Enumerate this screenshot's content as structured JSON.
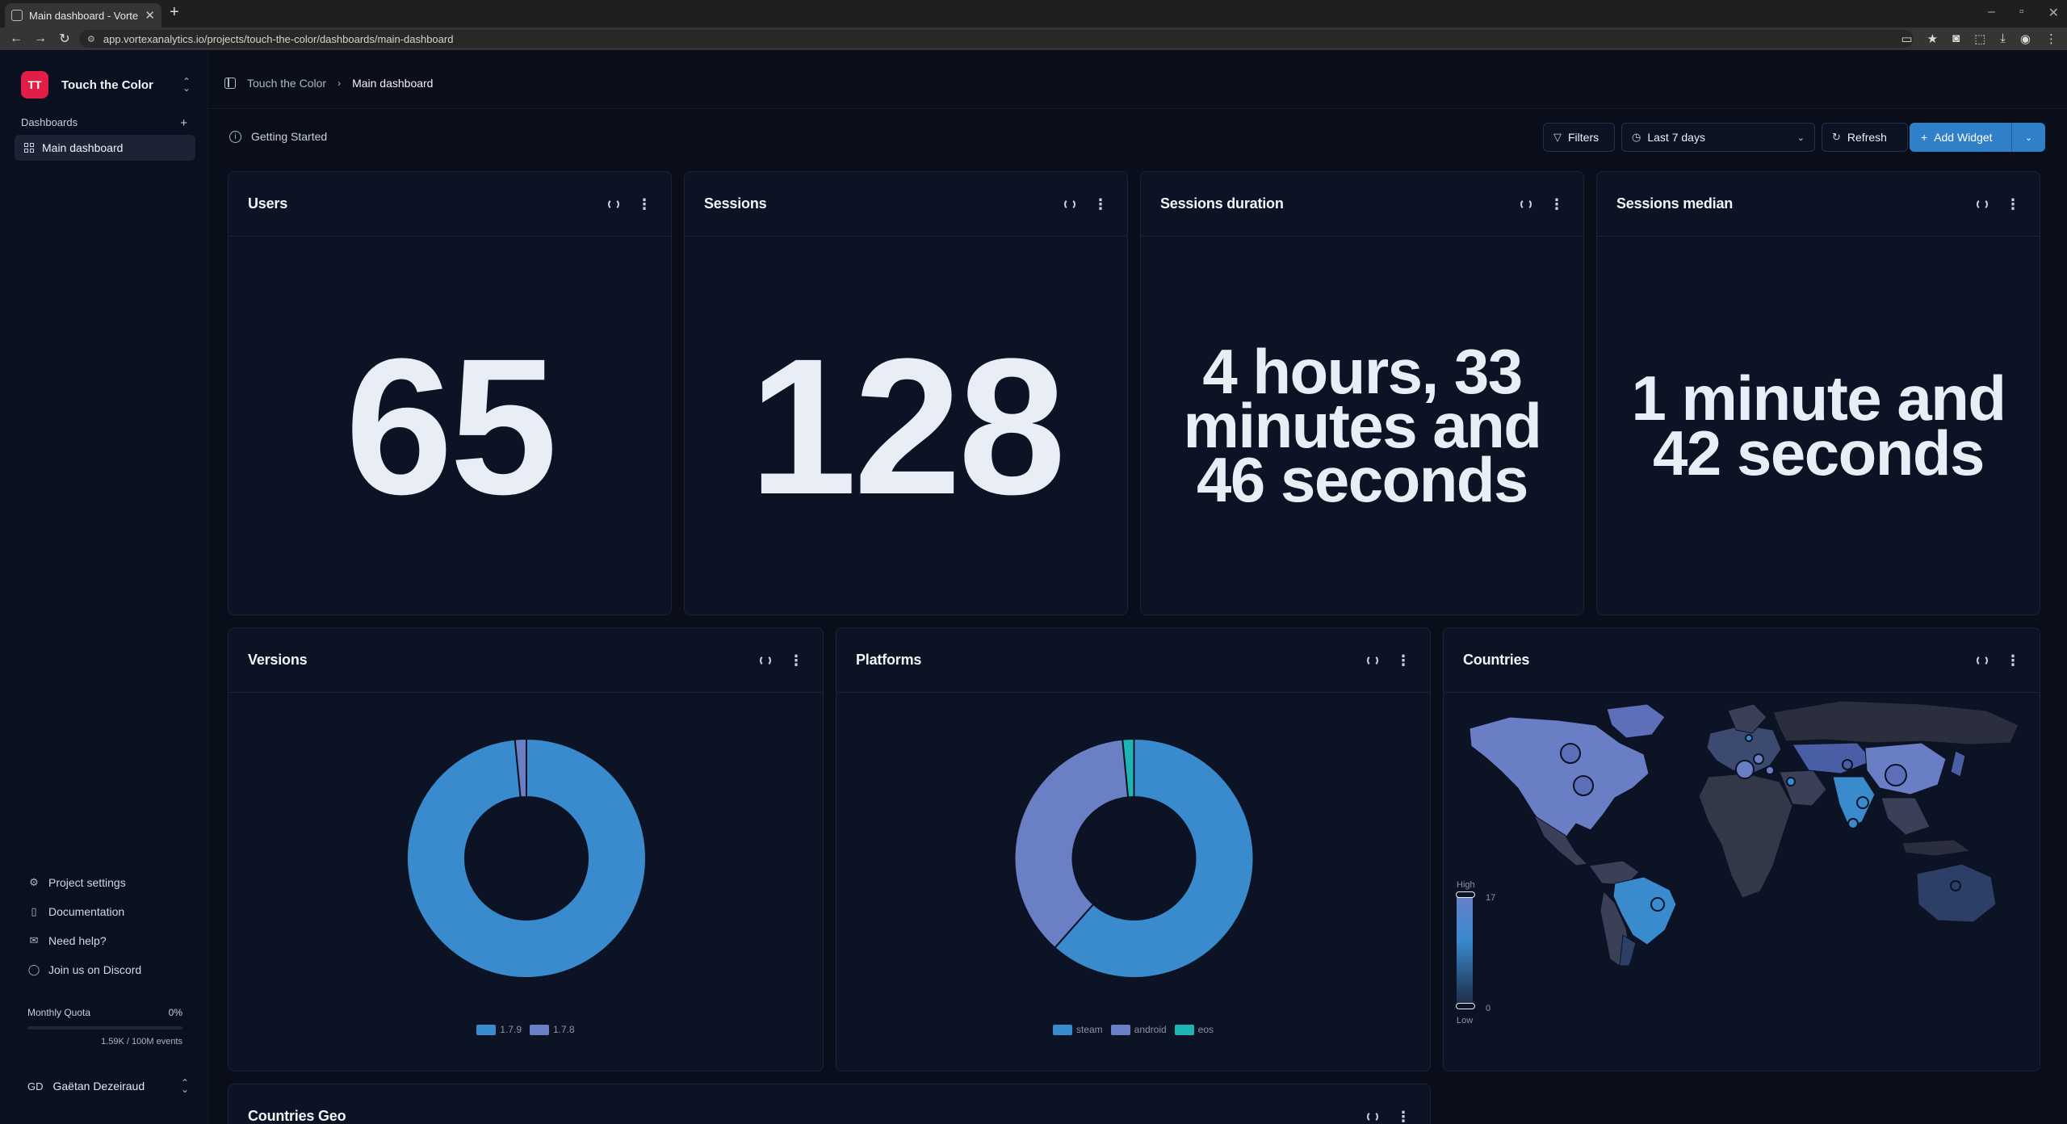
{
  "browser": {
    "tab_title": "Main dashboard - Vortex",
    "url": "app.vortexanalytics.io/projects/touch-the-color/dashboards/main-dashboard"
  },
  "sidebar": {
    "project_initials": "TT",
    "project_name": "Touch the Color",
    "section_label": "Dashboards",
    "active_item": "Main dashboard",
    "links": [
      {
        "label": "Project settings",
        "icon": "gear-icon"
      },
      {
        "label": "Documentation",
        "icon": "book-icon"
      },
      {
        "label": "Need help?",
        "icon": "mail-icon"
      },
      {
        "label": "Join us on Discord",
        "icon": "chat-icon"
      }
    ],
    "quota_label": "Monthly Quota",
    "quota_percent": "0%",
    "quota_fraction": 0,
    "quota_events": "1.59K / 100M events",
    "user_initials": "GD",
    "user_name": "Gaëtan Dezeiraud"
  },
  "header": {
    "crumb_project": "Touch the Color",
    "crumb_current": "Main dashboard",
    "getting_started": "Getting Started",
    "filters_label": "Filters",
    "range_label": "Last 7 days",
    "refresh_label": "Refresh",
    "add_widget_label": "Add Widget"
  },
  "widgets": {
    "users": {
      "title": "Users",
      "value": "65"
    },
    "sessions": {
      "title": "Sessions",
      "value": "128"
    },
    "duration": {
      "title": "Sessions duration",
      "value": "4 hours, 33 minutes and 46 seconds"
    },
    "median": {
      "title": "Sessions median",
      "value": "1 minute and 42 seconds"
    },
    "versions": {
      "title": "Versions"
    },
    "platforms": {
      "title": "Platforms"
    },
    "countries": {
      "title": "Countries",
      "scale_high": "High",
      "scale_low": "Low",
      "scale_max": "17",
      "scale_min": "0"
    },
    "geo": {
      "title": "Countries Geo"
    }
  },
  "colors": {
    "accent": "#2f7fc9",
    "blue": "#3a8bcd",
    "purple": "#6b7fc4",
    "teal": "#1fb3b3",
    "brand": "#e11d48"
  },
  "chart_data": [
    {
      "type": "pie",
      "title": "Versions",
      "categories": [
        "1.7.9",
        "1.7.8"
      ],
      "values": [
        64,
        1
      ],
      "colors": [
        "#3a8bcd",
        "#6b7fc4"
      ]
    },
    {
      "type": "pie",
      "title": "Platforms",
      "categories": [
        "steam",
        "android",
        "eos"
      ],
      "values": [
        40,
        24,
        1
      ],
      "colors": [
        "#3a8bcd",
        "#6b7fc4",
        "#1fb3b3"
      ]
    }
  ]
}
